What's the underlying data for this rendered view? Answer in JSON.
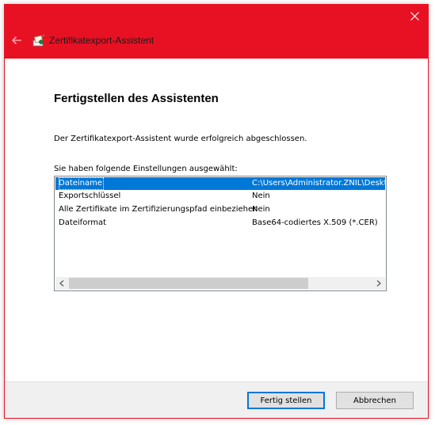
{
  "window": {
    "title": "Zertifikatexport-Assistent",
    "icons": {
      "back": "back-arrow-icon",
      "close": "close-icon",
      "app": "certificate-icon"
    },
    "colors": {
      "titlebar": "#e81123",
      "selection": "#0078d7"
    }
  },
  "page": {
    "heading": "Fertigstellen des Assistenten",
    "description": "Der Zertifikatexport-Assistent wurde erfolgreich abgeschlossen.",
    "settings_label": "Sie haben folgende Einstellungen ausgewählt:"
  },
  "settings_list": {
    "rows": [
      {
        "name": "Dateiname",
        "value": "C:\\Users\\Administrator.ZNIL\\Deskt",
        "selected": true
      },
      {
        "name": "Exportschlüssel",
        "value": "Nein",
        "selected": false
      },
      {
        "name": "Alle Zertifikate im Zertifizierungspfad einbeziehen",
        "value": "Nein",
        "selected": false
      },
      {
        "name": "Dateiformat",
        "value": "Base64-codiertes X.509 (*.CER)",
        "selected": false
      }
    ],
    "scroll_icons": {
      "left": "chevron-left-icon",
      "right": "chevron-right-icon"
    }
  },
  "footer": {
    "finish_label": "Fertig stellen",
    "cancel_label": "Abbrechen"
  }
}
